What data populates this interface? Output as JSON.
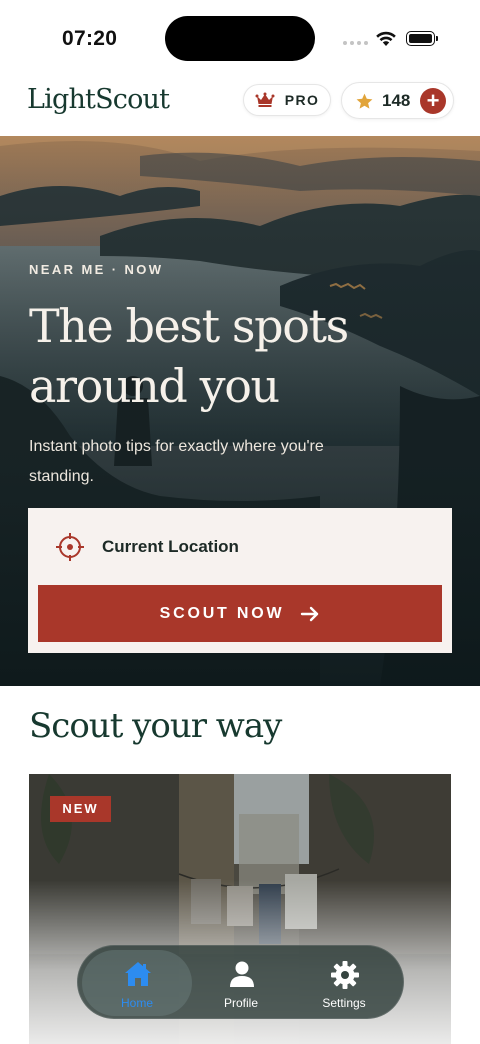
{
  "status_bar": {
    "time": "07:20"
  },
  "header": {
    "brand": "LightScout",
    "pro_label": "PRO",
    "credits": "148",
    "add_symbol": "+"
  },
  "hero": {
    "kicker": "NEAR ME · NOW",
    "title": "The best spots around you",
    "subtitle": "Instant photo tips for exactly where you're standing.",
    "location_label": "Current Location",
    "cta_label": "SCOUT NOW"
  },
  "section": {
    "title": "Scout your way",
    "card_badge": "NEW"
  },
  "tabs": [
    {
      "label": "Home",
      "icon": "home-icon",
      "active": true
    },
    {
      "label": "Profile",
      "icon": "person-icon",
      "active": false
    },
    {
      "label": "Settings",
      "icon": "gear-icon",
      "active": false
    }
  ],
  "colors": {
    "accent": "#a9372a",
    "brand_green": "#17392f",
    "tab_active": "#2d8cf0"
  }
}
